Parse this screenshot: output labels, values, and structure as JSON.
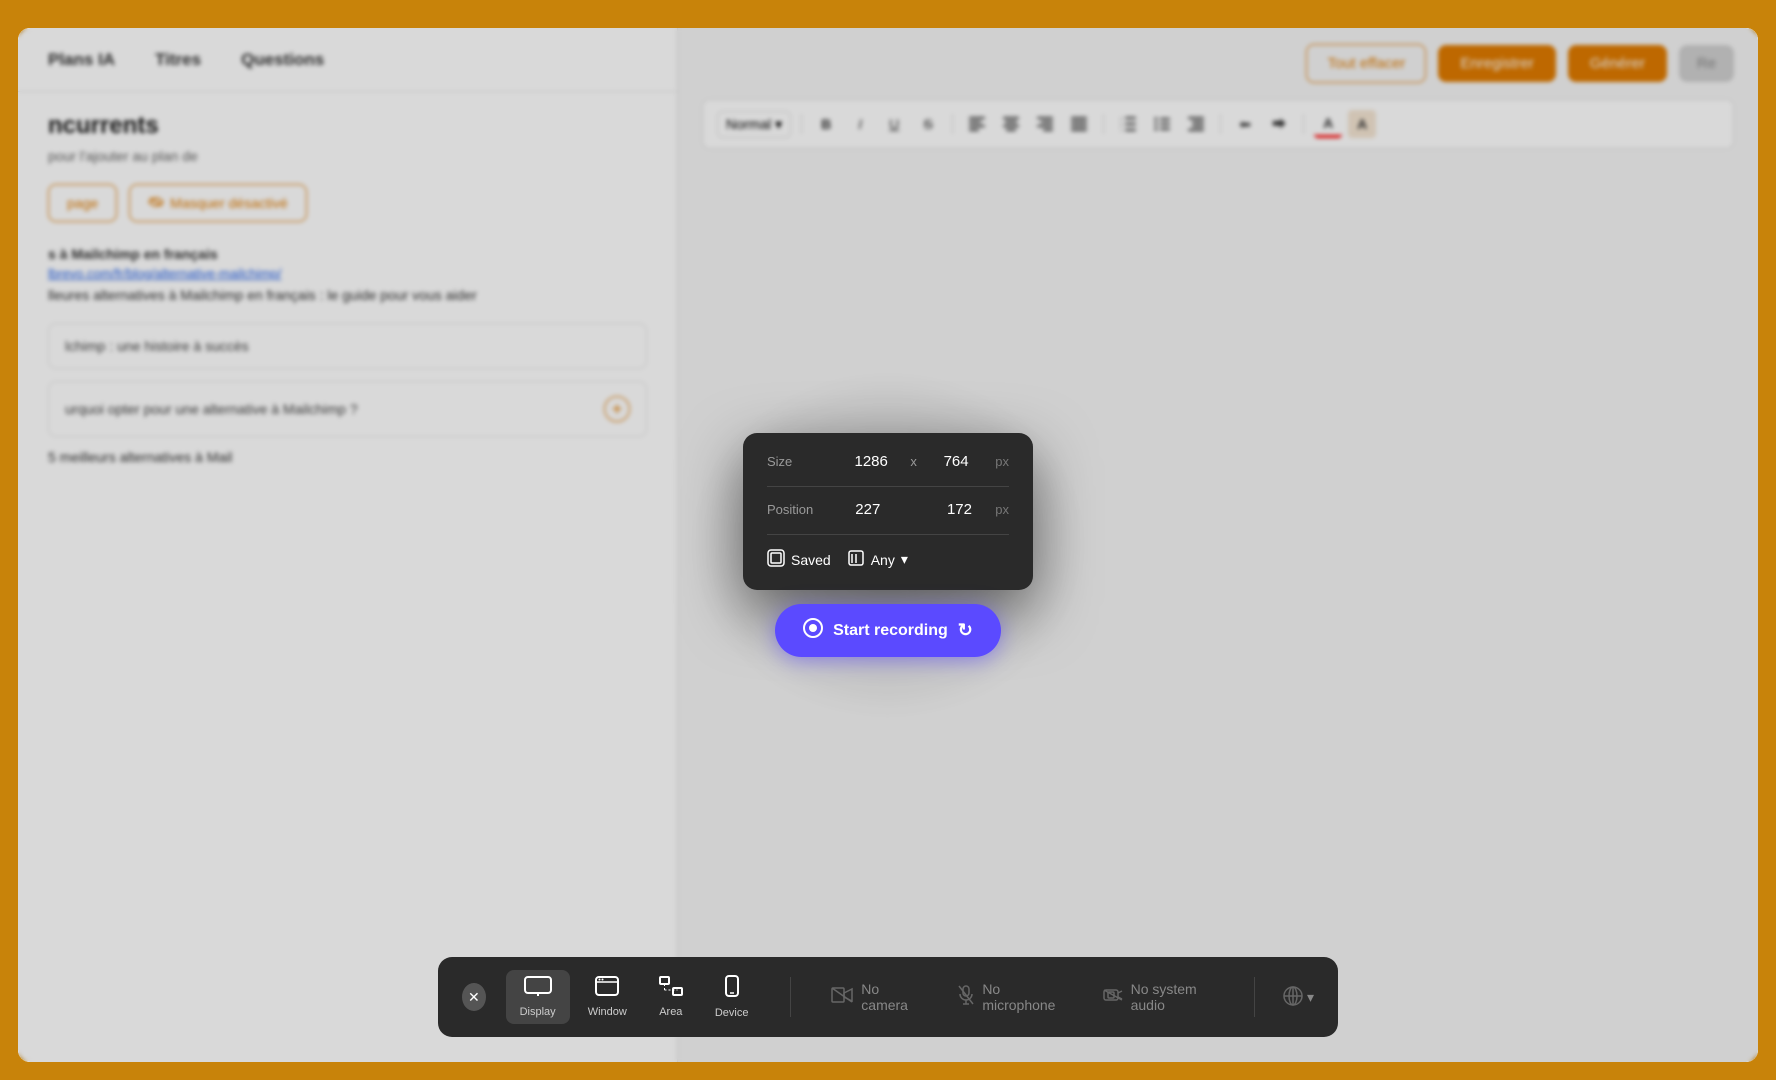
{
  "app": {
    "background_color": "#c8830a"
  },
  "left_panel": {
    "tabs": [
      {
        "label": "Plans IA"
      },
      {
        "label": "Titres"
      },
      {
        "label": "Questions"
      }
    ],
    "section_title": "ncurrents",
    "section_subtitle": "pour l'ajouter au plan de",
    "buttons": [
      {
        "label": "page"
      },
      {
        "label": "Masquer désactivé"
      }
    ],
    "article_label": "s à Mailchimp en français",
    "article_link": "lbrevo.com/fr/blog/alternative-mailchimp/",
    "article_title": "lleures alternatives à Mailchimp en français : le guide pour vous aider",
    "content_blocks": [
      {
        "text": "lchimp : une histoire à succès"
      },
      {
        "text": "urquoi opter pour une alternative à Mailchimp ?",
        "has_icon": true
      },
      {
        "text": "5 meilleurs alternatives à Mail"
      }
    ]
  },
  "right_panel": {
    "buttons": [
      {
        "label": "Tout effacer",
        "type": "outline"
      },
      {
        "label": "Enregistrer",
        "type": "solid"
      },
      {
        "label": "Générer",
        "type": "solid"
      },
      {
        "label": "Re",
        "type": "gray"
      }
    ],
    "toolbar": {
      "format_label": "Normal",
      "format_arrow": "▾"
    }
  },
  "size_popup": {
    "size_label": "Size",
    "width": "1286",
    "x_separator": "x",
    "height": "764",
    "unit_size": "px",
    "position_label": "Position",
    "pos_x": "227",
    "pos_y": "172",
    "unit_pos": "px",
    "saved_label": "Saved",
    "any_label": "Any",
    "any_arrow": "▾"
  },
  "recording_button": {
    "label": "Start recording",
    "icon": "⊙",
    "spinner": "↻"
  },
  "bottom_bar": {
    "close_icon": "✕",
    "options": [
      {
        "label": "Display",
        "icon": "▭"
      },
      {
        "label": "Window",
        "icon": "⬜"
      },
      {
        "label": "Area",
        "icon": "⬚"
      },
      {
        "label": "Device",
        "icon": "📱"
      }
    ],
    "media_options": [
      {
        "label": "No camera",
        "icon": "📷"
      },
      {
        "label": "No microphone",
        "icon": "🎤"
      },
      {
        "label": "No system audio",
        "icon": "🖥"
      }
    ],
    "globe_icon": "🌐"
  },
  "toolbar_buttons": [
    {
      "label": "B",
      "class": "bold"
    },
    {
      "label": "I",
      "class": "italic"
    },
    {
      "label": "U",
      "class": "underline"
    },
    {
      "label": "S",
      "class": "strike"
    },
    {
      "label": "≡",
      "class": "align-left"
    },
    {
      "label": "≡",
      "class": "align-center"
    },
    {
      "label": "≡",
      "class": "align-right"
    },
    {
      "label": "≡",
      "class": "align-justify"
    },
    {
      "label": "≔",
      "class": "ol"
    },
    {
      "label": "≔",
      "class": "ul"
    },
    {
      "label": "≔",
      "class": "indent"
    },
    {
      "label": "⬅",
      "class": "outdent"
    },
    {
      "label": "⬅",
      "class": "indent2"
    },
    {
      "label": "A",
      "class": "text-color"
    },
    {
      "label": "A̲",
      "class": "text-highlight"
    }
  ]
}
